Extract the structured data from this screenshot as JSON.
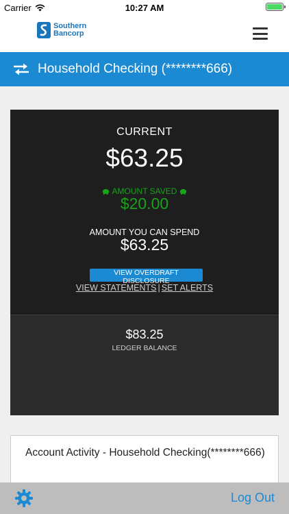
{
  "statusbar": {
    "carrier": "Carrier",
    "time": "10:27 AM"
  },
  "header": {
    "logo_line1": "Southern",
    "logo_line2": "Bancorp",
    "menu_icon": "hamburger-icon"
  },
  "account_bar": {
    "title": "Household Checking (********666)",
    "icon": "swap-arrows-icon"
  },
  "balance": {
    "current_label": "CURRENT",
    "current_amount": "$63.25",
    "saved_label": "AMOUNT SAVED",
    "saved_amount": "$20.00",
    "spend_label": "AMOUNT YOU CAN SPEND",
    "spend_amount": "$63.25",
    "overdraft_button": "VIEW OVERDRAFT DISCLOSURE",
    "view_statements": "VIEW STATEMENTS",
    "separator": "|",
    "set_alerts": "SET ALERTS",
    "ledger_amount": "$83.25",
    "ledger_label": "LEDGER BALANCE"
  },
  "activity": {
    "title": "Account Activity - Household Checking(********666)"
  },
  "toolbar": {
    "settings_icon": "gear-icon",
    "logout": "Log Out"
  },
  "colors": {
    "accent": "#1b8ad3",
    "saved_green": "#19a21a",
    "card_dark": "#1e1e1e",
    "toolbar_grey": "#bdbdbd"
  }
}
